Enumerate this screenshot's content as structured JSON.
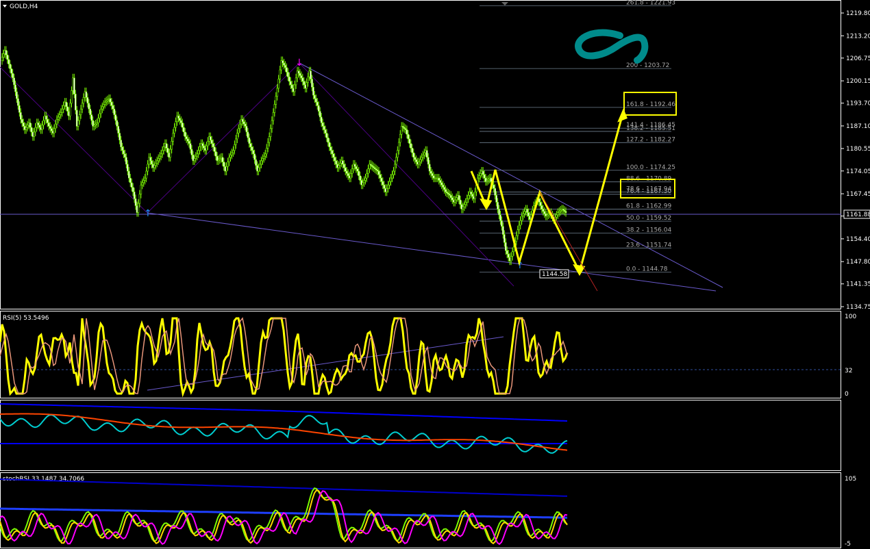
{
  "chart_data": {
    "type": "candlestick",
    "symbol": "GOLD,H4",
    "price_axis": {
      "ticks": [
        "1219.80",
        "1213.20",
        "1206.75",
        "1200.15",
        "1193.70",
        "1187.10",
        "1180.55",
        "1174.05",
        "1167.45",
        "1161.00",
        "1154.40",
        "1147.80",
        "1141.35",
        "1134.75"
      ],
      "ylim": [
        1134.75,
        1219.8
      ],
      "current_price": "1161.88"
    },
    "price_path": [
      1206,
      1209,
      1205,
      1201,
      1195,
      1189,
      1186,
      1188,
      1184,
      1188,
      1186,
      1190,
      1187,
      1185,
      1189,
      1191,
      1194,
      1190,
      1201,
      1187,
      1192,
      1197,
      1192,
      1187,
      1188,
      1192,
      1194,
      1195,
      1192,
      1187,
      1181,
      1178,
      1172,
      1168,
      1162,
      1170,
      1172,
      1178,
      1175,
      1177,
      1179,
      1182,
      1178,
      1185,
      1190,
      1188,
      1184,
      1182,
      1177,
      1179,
      1182,
      1180,
      1184,
      1181,
      1177,
      1178,
      1174,
      1178,
      1180,
      1185,
      1189,
      1187,
      1182,
      1179,
      1174,
      1177,
      1179,
      1184,
      1191,
      1198,
      1206,
      1204,
      1200,
      1197,
      1203,
      1201,
      1198,
      1203,
      1196,
      1193,
      1188,
      1185,
      1181,
      1178,
      1175,
      1177,
      1174,
      1172,
      1176,
      1174,
      1170,
      1172,
      1176,
      1175,
      1174,
      1171,
      1168,
      1171,
      1174,
      1180,
      1187,
      1186,
      1182,
      1178,
      1176,
      1178,
      1180,
      1174,
      1172,
      1172,
      1170,
      1168,
      1167,
      1165,
      1167,
      1163,
      1165,
      1168,
      1166,
      1172,
      1174,
      1171,
      1172,
      1169,
      1163,
      1158,
      1151,
      1148,
      1152,
      1157,
      1161,
      1163,
      1160,
      1164,
      1166,
      1163,
      1161,
      1162,
      1160,
      1162,
      1163,
      1162
    ],
    "fibonacci": {
      "levels": [
        {
          "label": "0.0 - 1144.78",
          "value": 1144.78
        },
        {
          "label": "23.6 - 1151.74",
          "value": 1151.74
        },
        {
          "label": "38.2 - 1156.04",
          "value": 1156.04
        },
        {
          "label": "50.0 - 1159.52",
          "value": 1159.52
        },
        {
          "label": "61.8 - 1162.99",
          "value": 1162.99
        },
        {
          "label": "76.4 - 1167.30",
          "value": 1167.3
        },
        {
          "label": "78.6 - 1167.94",
          "value": 1167.94
        },
        {
          "label": "88.6 - 1170.89",
          "value": 1170.89
        },
        {
          "label": "100.0 - 1174.25",
          "value": 1174.25
        },
        {
          "label": "127.2 - 1182.27",
          "value": 1182.27
        },
        {
          "label": "138.2 - 1185.51",
          "value": 1185.51
        },
        {
          "label": "141.4 - 1186.45",
          "value": 1186.45
        },
        {
          "label": "161.8 - 1192.46",
          "value": 1192.46
        },
        {
          "label": "200 - 1203.72",
          "value": 1203.72
        },
        {
          "label": "261.8 - 1221.93",
          "value": 1221.93
        }
      ],
      "highlighted": [
        "161.8 - 1192.46",
        "78.6 - 1167.94"
      ]
    },
    "low_label": "1144.58",
    "rsi": {
      "title": "RSI(5) 53.5496",
      "levels": [
        "100",
        "32",
        "0"
      ]
    },
    "stochrsi": {
      "title": "stochRSI 33.1487 34.7066",
      "levels": [
        "105",
        "-5"
      ]
    }
  },
  "colors": {
    "bull": "#7CFC00",
    "bear": "#7CFC00",
    "arrow": "#FFFF00",
    "fib": "#708090",
    "trend": "#6A5ACD",
    "teal": "#008B8B"
  }
}
